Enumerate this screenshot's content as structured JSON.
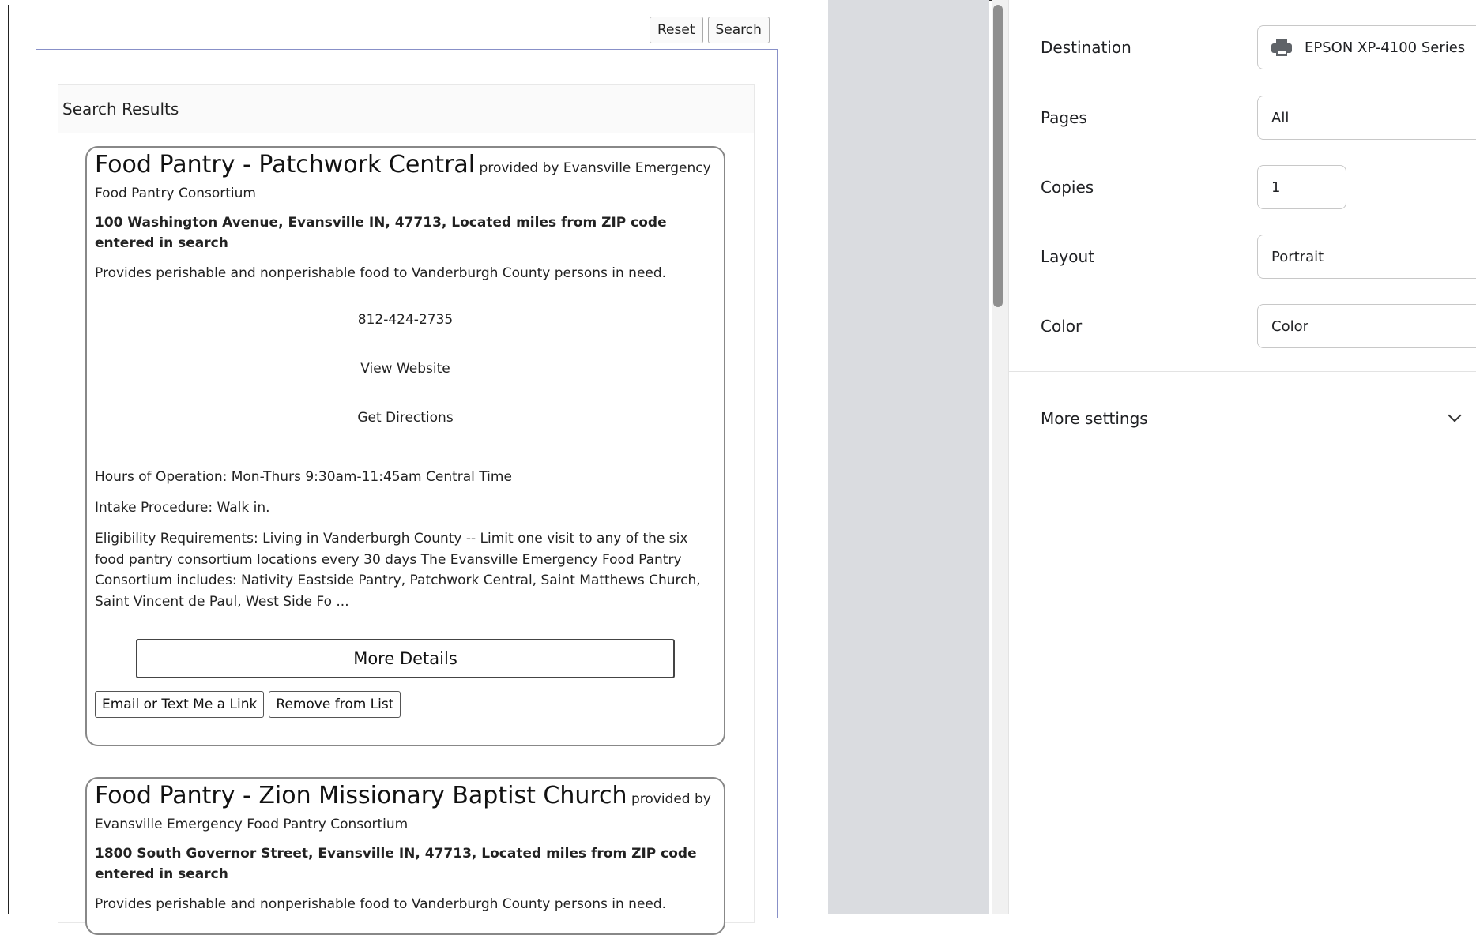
{
  "search_bar": {
    "reset_label": "Reset",
    "search_label": "Search"
  },
  "results": {
    "heading": "Search Results",
    "cards": [
      {
        "title": "Food Pantry - Patchwork Central",
        "provider_prefix": "provided by Evansville Emergency",
        "provider_rest": "Food Pantry Consortium",
        "address": "100 Washington Avenue, Evansville IN, 47713, Located miles from ZIP code entered in search",
        "description": "Provides perishable and nonperishable food to Vanderburgh County persons in need.",
        "phone": "812-424-2735",
        "website_label": "View Website",
        "directions_label": "Get Directions",
        "hours": "Hours of Operation: Mon-Thurs 9:30am-11:45am Central Time",
        "intake": "Intake Procedure: Walk in.",
        "eligibility": "Eligibility Requirements: Living in Vanderburgh County -- Limit one visit to any of the six food pantry consortium locations every 30 days The Evansville Emergency Food Pantry Consortium includes: Nativity Eastside Pantry, Patchwork Central, Saint Matthews Church, Saint Vincent de Paul, West Side Fo ...",
        "more_details_label": "More Details",
        "email_label": "Email or Text Me a Link",
        "remove_label": "Remove from List"
      },
      {
        "title": "Food Pantry - Zion Missionary Baptist Church",
        "provider_prefix": "provided by",
        "provider_rest": "Evansville Emergency Food Pantry Consortium",
        "address": "1800 South Governor Street, Evansville IN, 47713, Located miles from ZIP code entered in search",
        "description": "Provides perishable and nonperishable food to Vanderburgh County persons in need."
      }
    ]
  },
  "print_settings": {
    "destination": {
      "label": "Destination",
      "value": "EPSON XP-4100 Series",
      "icon": "printer-icon"
    },
    "pages": {
      "label": "Pages",
      "value": "All"
    },
    "copies": {
      "label": "Copies",
      "value": "1"
    },
    "layout": {
      "label": "Layout",
      "value": "Portrait"
    },
    "color": {
      "label": "Color",
      "value": "Color"
    },
    "more_settings": "More settings"
  }
}
